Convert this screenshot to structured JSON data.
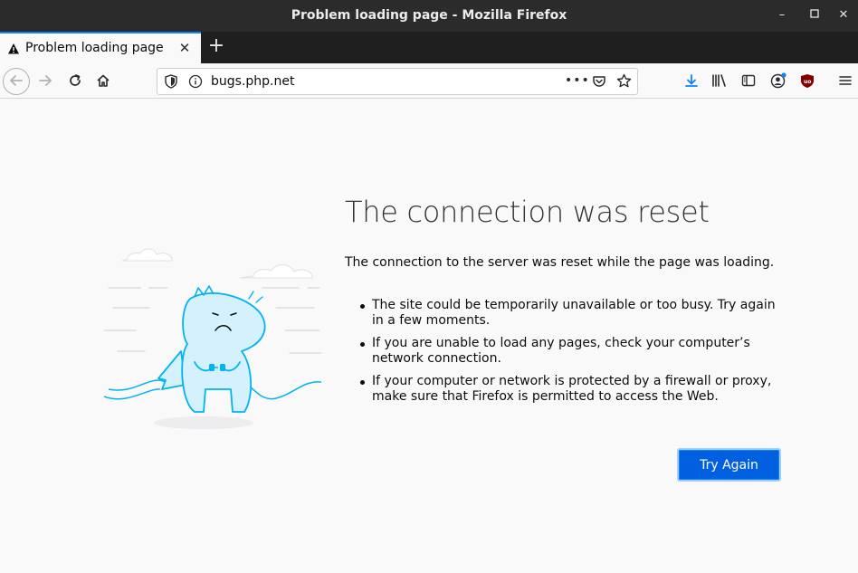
{
  "window": {
    "title": "Problem loading page - Mozilla Firefox"
  },
  "tabs": [
    {
      "label": "Problem loading page",
      "icon": "warning-icon"
    }
  ],
  "urlbar": {
    "url": "bugs.php.net"
  },
  "error": {
    "title": "The connection was reset",
    "description": "The connection to the server was reset while the page was loading.",
    "suggestions": [
      "The site could be temporarily unavailable or too busy. Try again in a few moments.",
      "If you are unable to load any pages, check your computer’s network connection.",
      "If your computer or network is protected by a firewall or proxy, make sure that Firefox is permitted to access the Web."
    ],
    "button_label": "Try Again"
  },
  "colors": {
    "accent": "#0060df",
    "titlebar": "#2b2b2b",
    "illustration": "#00b3f4"
  }
}
